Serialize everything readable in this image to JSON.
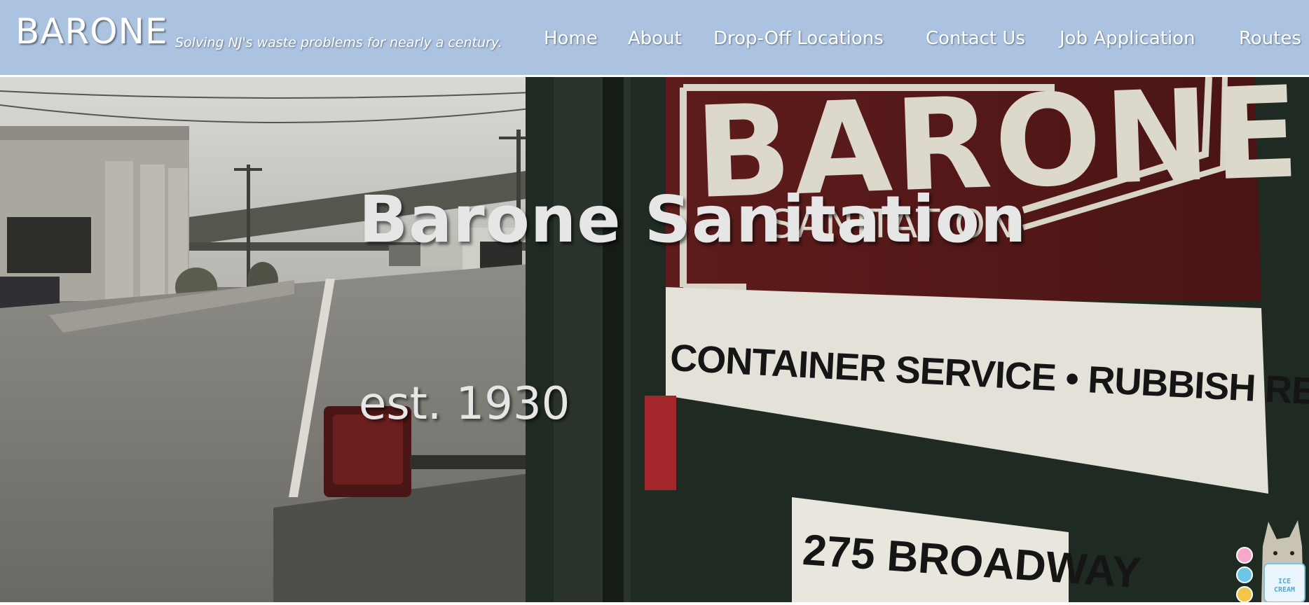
{
  "header": {
    "brand": "BARONE",
    "tagline": "Solving NJ's waste problems for nearly a century.",
    "background_color": "#abc3e0"
  },
  "nav": {
    "items": [
      {
        "label": "Home"
      },
      {
        "label": "About"
      },
      {
        "label": "Drop-Off Locations"
      },
      {
        "label": "Contact Us"
      },
      {
        "label": "Job Application"
      },
      {
        "label": "Routes"
      }
    ]
  },
  "hero": {
    "title": "Barone Sanitation",
    "subtitle": "est. 1930",
    "truck_sign": {
      "brand": "BARONE",
      "sub": "SANITATION",
      "services": "CONTAINER SERVICE • RUBBISH REMOVAL",
      "address": "275 BROADWAY"
    }
  },
  "widget": {
    "icon": "pusheen-ice-cream-icon",
    "label": "ICE CREAM"
  }
}
